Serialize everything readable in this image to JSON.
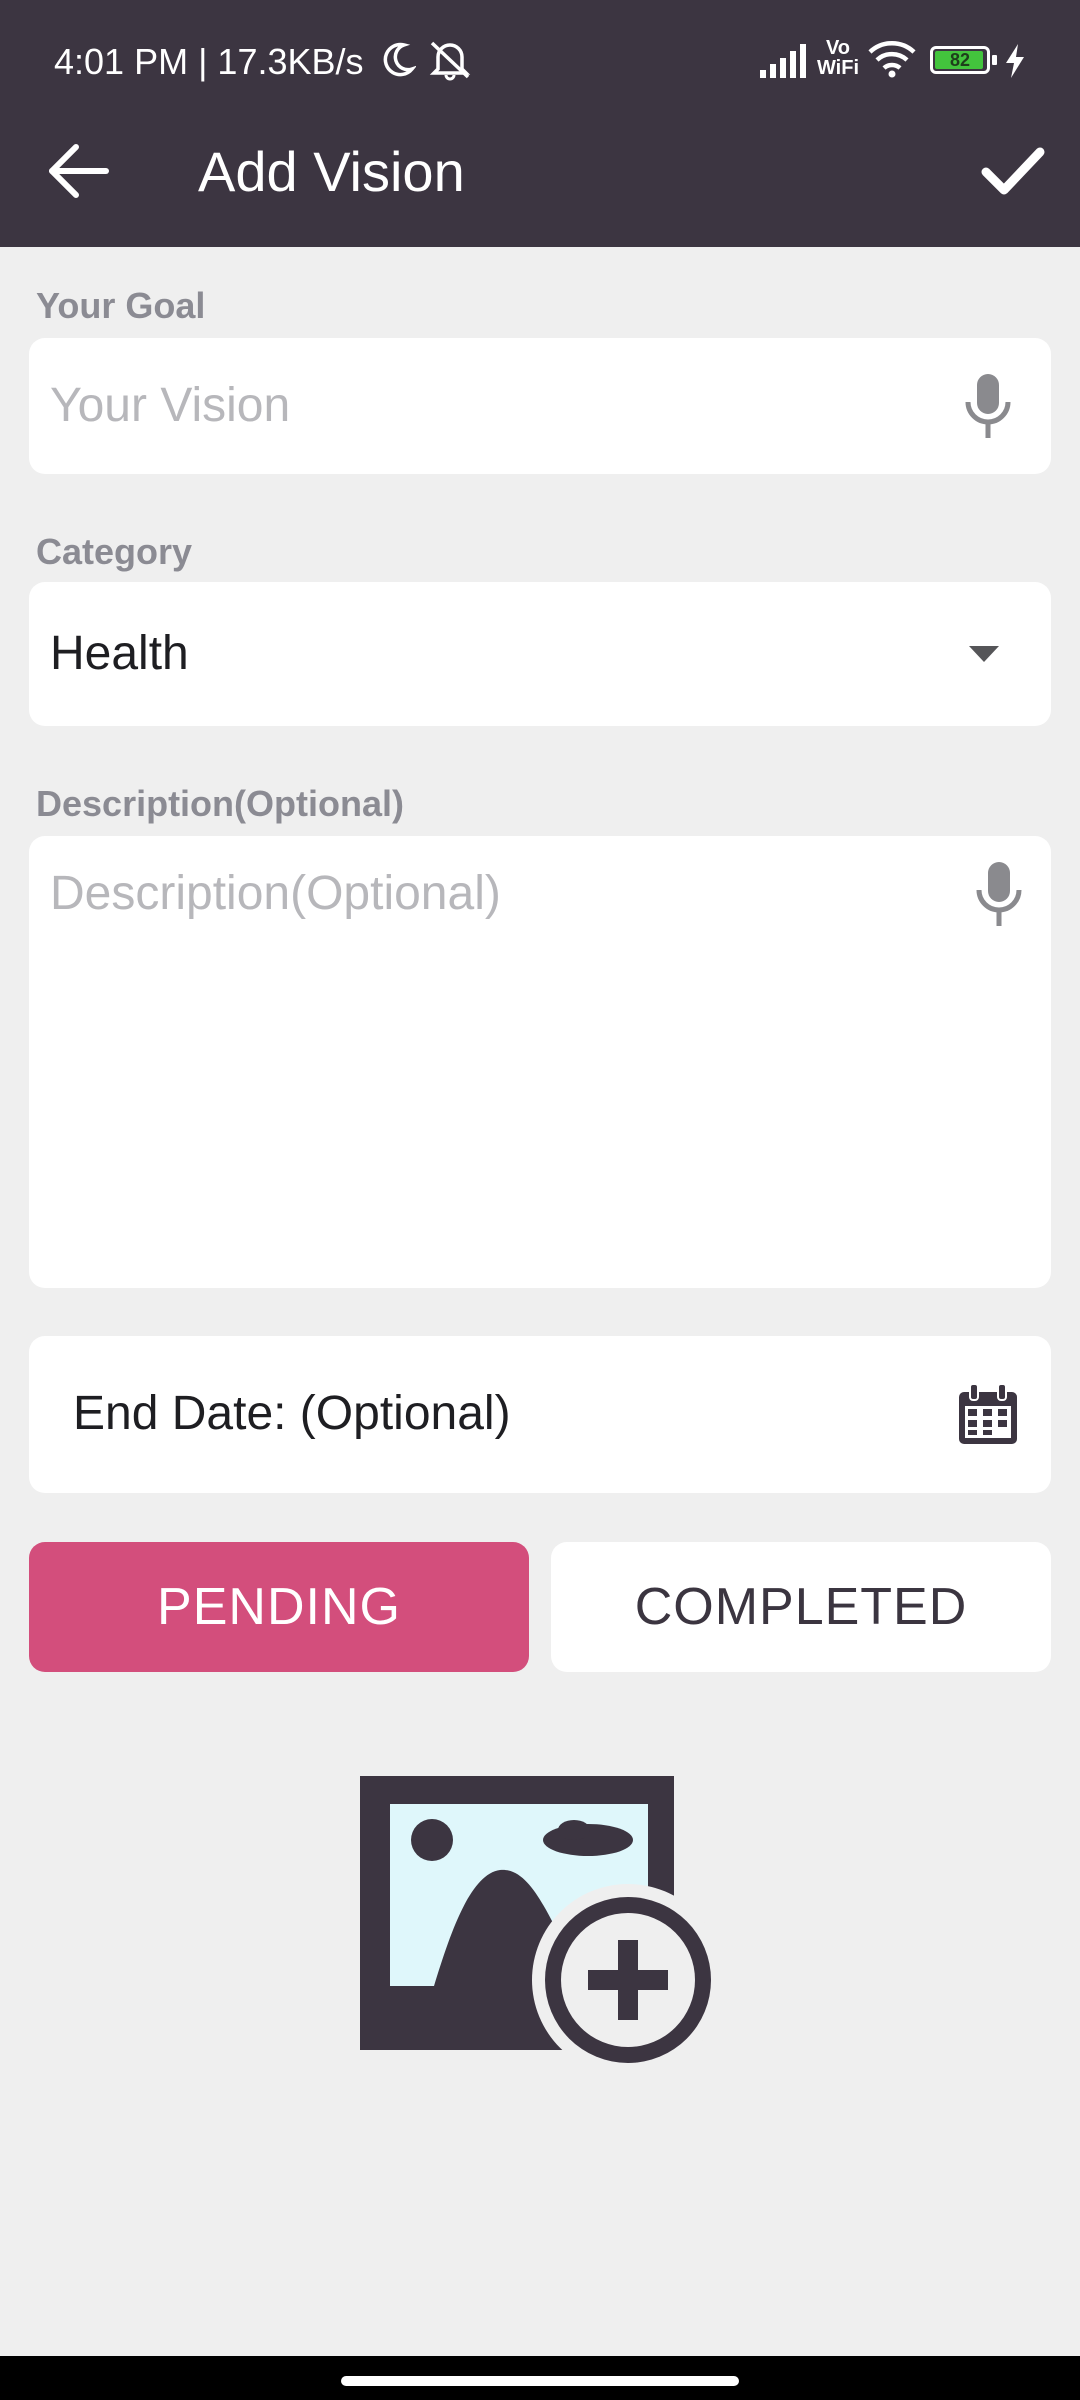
{
  "status_bar": {
    "time_speed": "4:01 PM | 17.3KB/s",
    "battery": "82",
    "network": "Vo WiFi"
  },
  "app_bar": {
    "title": "Add Vision",
    "back_icon": "arrow-left-icon",
    "confirm_icon": "check-icon"
  },
  "form": {
    "goal": {
      "label": "Your Goal",
      "placeholder": "Your Vision",
      "mic_icon": "mic-icon"
    },
    "category": {
      "label": "Category",
      "value": "Health",
      "dropdown_icon": "caret-down-icon"
    },
    "description": {
      "label": "Description(Optional)",
      "placeholder": "Description(Optional)",
      "mic_icon": "mic-icon"
    },
    "end_date": {
      "text": "End Date: (Optional)",
      "calendar_icon": "calendar-icon"
    },
    "status": {
      "pending_label": "PENDING",
      "completed_label": "COMPLETED",
      "selected": "PENDING"
    },
    "image_picker_icon": "add-image-icon"
  },
  "colors": {
    "primary_dark": "#3c3541",
    "accent_pink": "#d34e7c",
    "background": "#efefef",
    "image_sky": "#dff7fb"
  }
}
